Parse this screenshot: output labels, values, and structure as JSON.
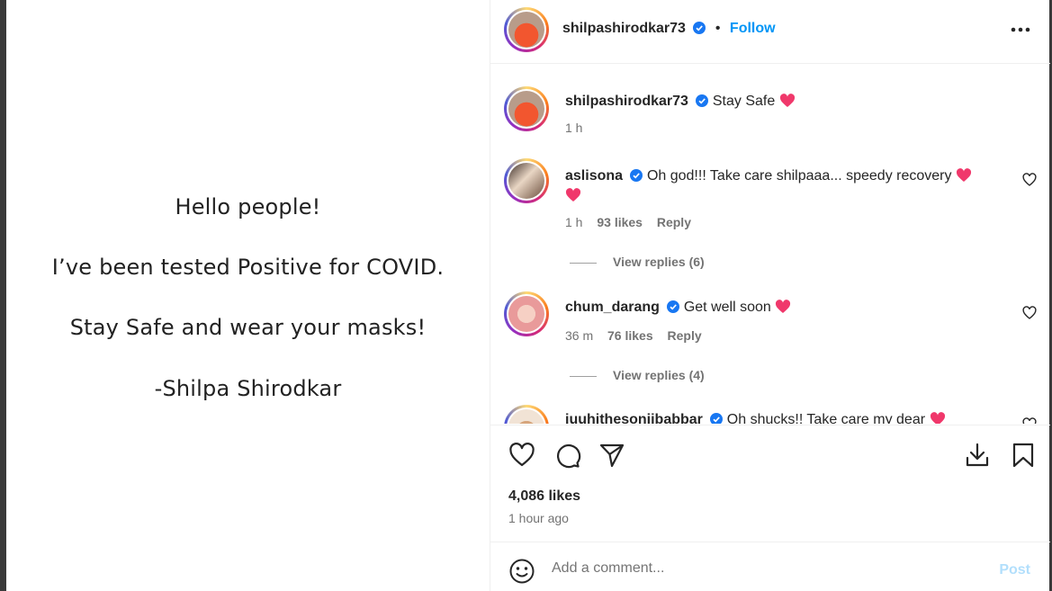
{
  "post_image": {
    "lines": [
      "Hello people!",
      "I’ve been tested Positive for COVID.",
      "Stay Safe and wear your masks!",
      "-Shilpa Shirodkar"
    ]
  },
  "header": {
    "username": "shilpashirodkar73",
    "separator": "•",
    "follow_label": "Follow",
    "more_icon": "more-horizontal-icon"
  },
  "caption": {
    "username": "shilpashirodkar73",
    "text": "Stay Safe",
    "time": "1 h"
  },
  "comments": [
    {
      "username": "aslisona",
      "text": "Oh god!!! Take care shilpaaa... speedy recovery",
      "time": "1 h",
      "likes": "93 likes",
      "reply_label": "Reply",
      "view_replies": "View replies (6)"
    },
    {
      "username": "chum_darang",
      "text": "Get well soon",
      "time": "36 m",
      "likes": "76 likes",
      "reply_label": "Reply",
      "view_replies": "View replies (4)"
    },
    {
      "username": "juuhithesonijbabbar",
      "text": "Oh shucks!! Take care my dear"
    }
  ],
  "actions": {
    "likes": "4,086 likes",
    "time": "1 hour ago"
  },
  "add_comment": {
    "placeholder": "Add a comment...",
    "post_label": "Post"
  },
  "colors": {
    "accent": "#0095f6",
    "heart": "#f0386b",
    "verified": "#1877f2",
    "muted": "#737373"
  }
}
